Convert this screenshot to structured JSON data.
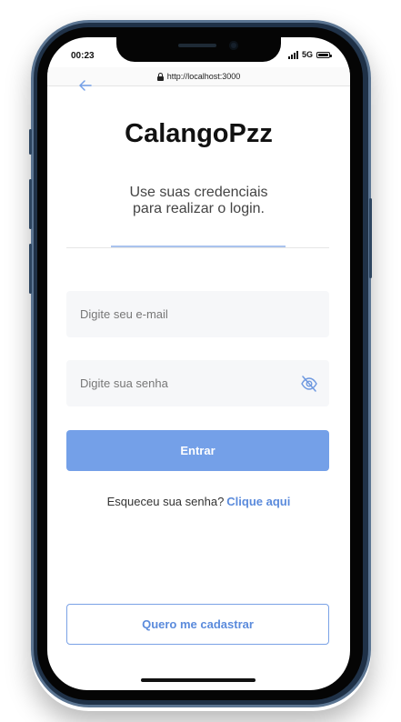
{
  "status": {
    "time": "00:23",
    "network": "5G"
  },
  "browser": {
    "url": "http://localhost:3000"
  },
  "login": {
    "title": "CalangoPzz",
    "subtitle_line1": "Use suas credenciais",
    "subtitle_line2": "para realizar o login.",
    "email_placeholder": "Digite seu e-mail",
    "password_placeholder": "Digite sua senha",
    "submit_label": "Entrar",
    "forgot_text": "Esqueceu sua senha?",
    "forgot_link": "Clique aqui",
    "register_label": "Quero me cadastrar"
  },
  "icons": {
    "back": "arrow-left-icon",
    "password_toggle": "eye-off-icon",
    "secure": "lock-icon"
  },
  "colors": {
    "primary": "#74a0e8",
    "link": "#5b8bdc",
    "field_bg": "#f6f7f9",
    "phone_frame": "#1f3147"
  }
}
